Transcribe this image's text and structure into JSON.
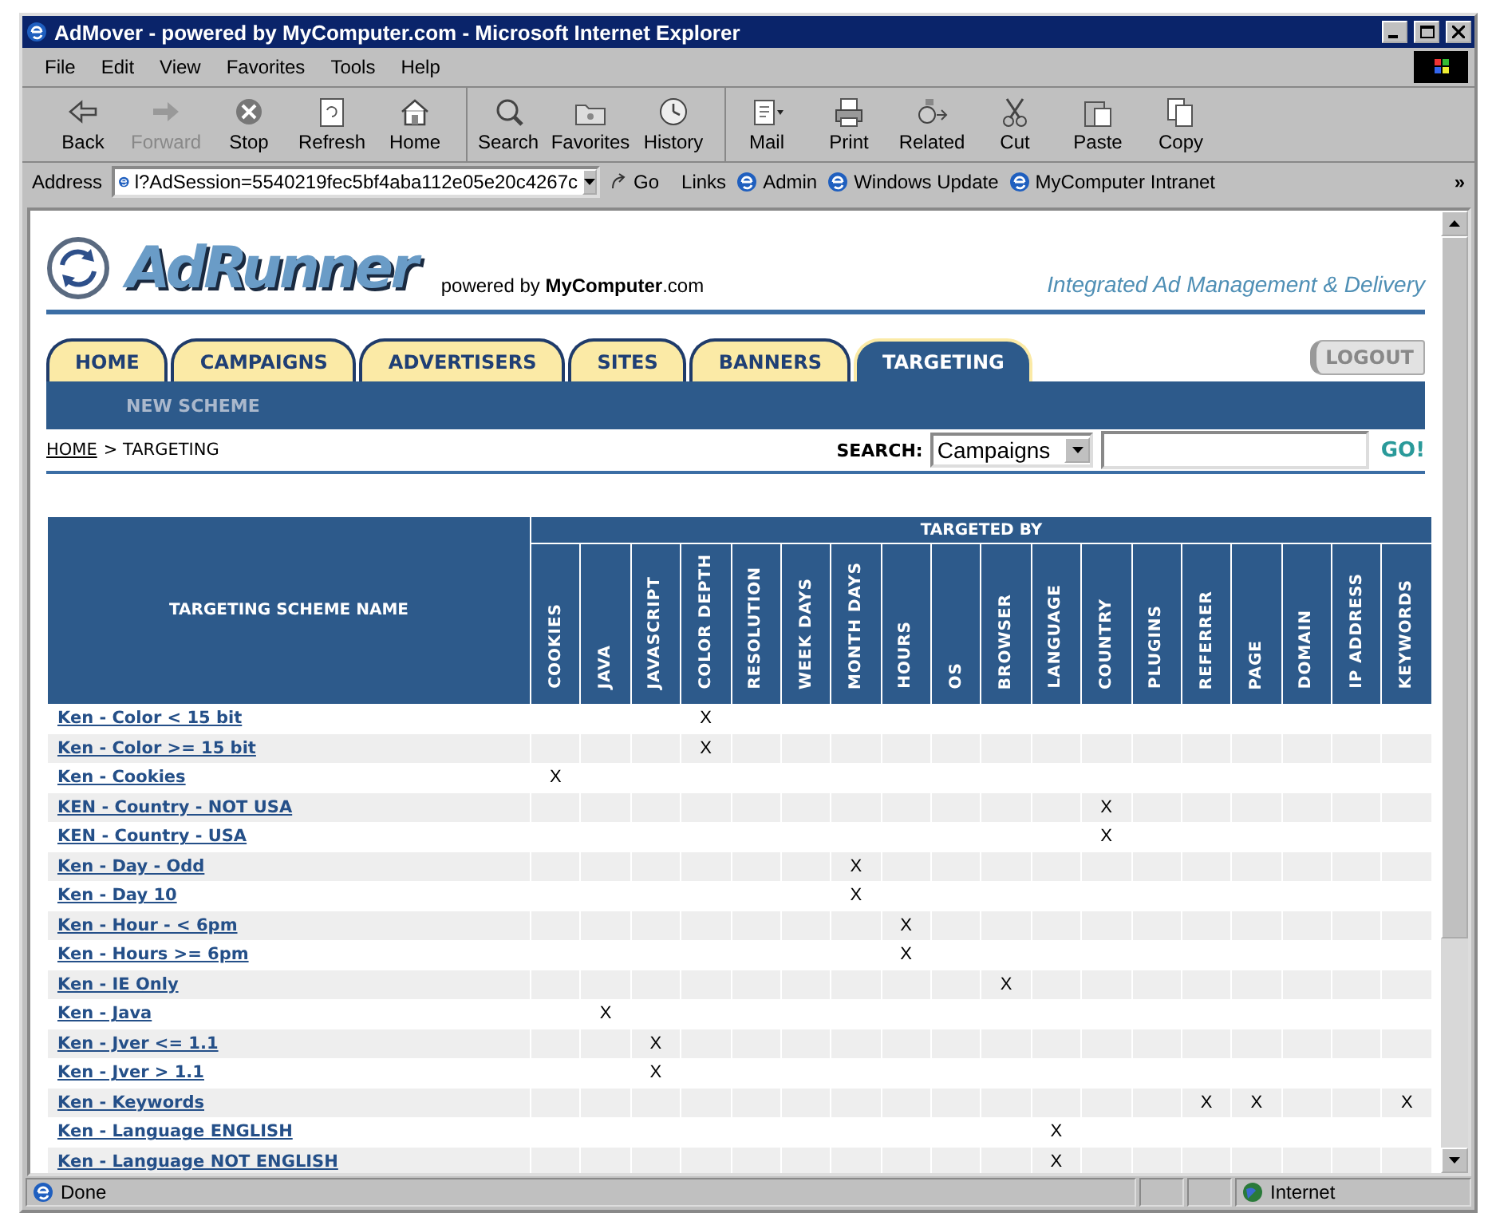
{
  "window": {
    "title": "AdMover - powered by MyComputer.com - Microsoft Internet Explorer"
  },
  "menu": [
    "File",
    "Edit",
    "View",
    "Favorites",
    "Tools",
    "Help"
  ],
  "toolbar": [
    {
      "label": "Back",
      "disabled": false
    },
    {
      "label": "Forward",
      "disabled": true
    },
    {
      "label": "Stop",
      "disabled": false
    },
    {
      "label": "Refresh",
      "disabled": false
    },
    {
      "label": "Home",
      "disabled": false
    },
    {
      "label": "Search",
      "disabled": false
    },
    {
      "label": "Favorites",
      "disabled": false
    },
    {
      "label": "History",
      "disabled": false
    },
    {
      "label": "Mail",
      "disabled": false
    },
    {
      "label": "Print",
      "disabled": false
    },
    {
      "label": "Related",
      "disabled": false
    },
    {
      "label": "Cut",
      "disabled": false
    },
    {
      "label": "Paste",
      "disabled": false
    },
    {
      "label": "Copy",
      "disabled": false
    }
  ],
  "address_bar": {
    "label": "Address",
    "value": "l?AdSession=5540219fec5bf4aba112e05e20c4267c",
    "go": "Go",
    "links_label": "Links",
    "links": [
      "Admin",
      "Windows Update",
      "MyComputer Intranet"
    ],
    "more": "»"
  },
  "header": {
    "logo": "AdRunner",
    "powered": "powered by **MyComputer**.com",
    "tagline": "Integrated Ad Management & Delivery"
  },
  "tabs": [
    {
      "label": "HOME",
      "selected": false
    },
    {
      "label": "CAMPAIGNS",
      "selected": false
    },
    {
      "label": "ADVERTISERS",
      "selected": false
    },
    {
      "label": "SITES",
      "selected": false
    },
    {
      "label": "BANNERS",
      "selected": false
    },
    {
      "label": "TARGETING",
      "selected": true
    }
  ],
  "logout": "LOGOUT",
  "subnav": [
    "NEW SCHEME"
  ],
  "breadcrumb": {
    "home": "HOME",
    "rest": "> TARGETING"
  },
  "search": {
    "label": "SEARCH:",
    "scope": "Campaigns",
    "go": "GO!"
  },
  "table": {
    "name_header": "TARGETING SCHEME NAME",
    "group_header": "TARGETED BY",
    "columns": [
      "COOKIES",
      "JAVA",
      "JAVASCRIPT",
      "COLOR DEPTH",
      "RESOLUTION",
      "WEEK DAYS",
      "MONTH DAYS",
      "HOURS",
      "OS",
      "BROWSER",
      "LANGUAGE",
      "COUNTRY",
      "PLUGINS",
      "REFERRER",
      "PAGE",
      "DOMAIN",
      "IP ADDRESS",
      "KEYWORDS"
    ],
    "rows": [
      {
        "name": "Ken - Color < 15 bit",
        "cells": [
          null,
          null,
          null,
          "X",
          null,
          null,
          null,
          null,
          null,
          null,
          null,
          null,
          null,
          null,
          null,
          null,
          null,
          null
        ]
      },
      {
        "name": "Ken - Color >= 15 bit",
        "cells": [
          null,
          null,
          null,
          "X",
          null,
          null,
          null,
          null,
          null,
          null,
          null,
          null,
          null,
          null,
          null,
          null,
          null,
          null
        ]
      },
      {
        "name": "Ken - Cookies",
        "cells": [
          "X",
          null,
          null,
          null,
          null,
          null,
          null,
          null,
          null,
          null,
          null,
          null,
          null,
          null,
          null,
          null,
          null,
          null
        ]
      },
      {
        "name": "KEN - Country - NOT USA",
        "cells": [
          null,
          null,
          null,
          null,
          null,
          null,
          null,
          null,
          null,
          null,
          null,
          "X",
          null,
          null,
          null,
          null,
          null,
          null
        ]
      },
      {
        "name": "KEN - Country - USA",
        "cells": [
          null,
          null,
          null,
          null,
          null,
          null,
          null,
          null,
          null,
          null,
          null,
          "X",
          null,
          null,
          null,
          null,
          null,
          null
        ]
      },
      {
        "name": "Ken - Day - Odd",
        "cells": [
          null,
          null,
          null,
          null,
          null,
          null,
          "X",
          null,
          null,
          null,
          null,
          null,
          null,
          null,
          null,
          null,
          null,
          null
        ]
      },
      {
        "name": "Ken - Day 10",
        "cells": [
          null,
          null,
          null,
          null,
          null,
          null,
          "X",
          null,
          null,
          null,
          null,
          null,
          null,
          null,
          null,
          null,
          null,
          null
        ]
      },
      {
        "name": "Ken - Hour - < 6pm",
        "cells": [
          null,
          null,
          null,
          null,
          null,
          null,
          null,
          "X",
          null,
          null,
          null,
          null,
          null,
          null,
          null,
          null,
          null,
          null
        ]
      },
      {
        "name": "Ken - Hours >= 6pm",
        "cells": [
          null,
          null,
          null,
          null,
          null,
          null,
          null,
          "X",
          null,
          null,
          null,
          null,
          null,
          null,
          null,
          null,
          null,
          null
        ]
      },
      {
        "name": "Ken - IE Only",
        "cells": [
          null,
          null,
          null,
          null,
          null,
          null,
          null,
          null,
          null,
          "X",
          null,
          null,
          null,
          null,
          null,
          null,
          null,
          null
        ]
      },
      {
        "name": "Ken - Java",
        "cells": [
          null,
          "X",
          null,
          null,
          null,
          null,
          null,
          null,
          null,
          null,
          null,
          null,
          null,
          null,
          null,
          null,
          null,
          null
        ]
      },
      {
        "name": "Ken - Jver <= 1.1",
        "cells": [
          null,
          null,
          "X",
          null,
          null,
          null,
          null,
          null,
          null,
          null,
          null,
          null,
          null,
          null,
          null,
          null,
          null,
          null
        ]
      },
      {
        "name": "Ken - Jver > 1.1",
        "cells": [
          null,
          null,
          "X",
          null,
          null,
          null,
          null,
          null,
          null,
          null,
          null,
          null,
          null,
          null,
          null,
          null,
          null,
          null
        ]
      },
      {
        "name": "Ken - Keywords",
        "cells": [
          null,
          null,
          null,
          null,
          null,
          null,
          null,
          null,
          null,
          null,
          null,
          null,
          null,
          "X",
          "X",
          null,
          null,
          "X"
        ]
      },
      {
        "name": "Ken - Language ENGLISH",
        "cells": [
          null,
          null,
          null,
          null,
          null,
          null,
          null,
          null,
          null,
          null,
          "X",
          null,
          null,
          null,
          null,
          null,
          null,
          null
        ]
      },
      {
        "name": "Ken - Language NOT ENGLISH",
        "cells": [
          null,
          null,
          null,
          null,
          null,
          null,
          null,
          null,
          null,
          null,
          "X",
          null,
          null,
          null,
          null,
          null,
          null,
          null
        ]
      }
    ]
  },
  "status_bar": {
    "text": "Done",
    "zone": "Internet"
  }
}
